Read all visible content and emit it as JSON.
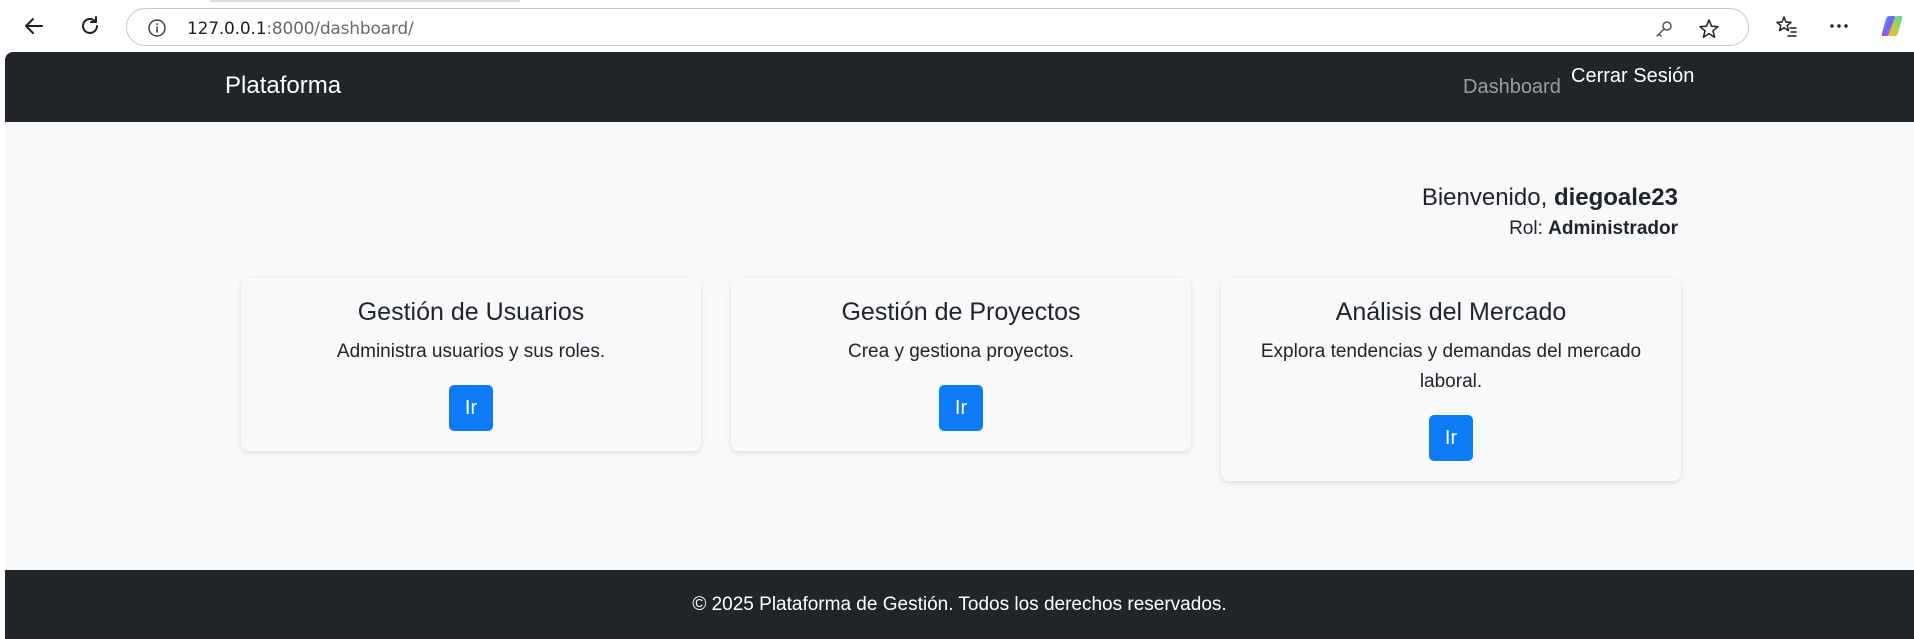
{
  "browser": {
    "url_host": "127.0.0.1",
    "url_rest": ":8000/dashboard/"
  },
  "navbar": {
    "brand": "Plataforma",
    "links": {
      "dashboard": "Dashboard",
      "logout": "Cerrar Sesión"
    }
  },
  "welcome": {
    "greeting": "Bienvenido,",
    "username": "diegoale23",
    "role_label": "Rol:",
    "role_value": "Administrador"
  },
  "cards": [
    {
      "title": "Gestión de Usuarios",
      "description": "Administra usuarios y sus roles.",
      "button": "Ir"
    },
    {
      "title": "Gestión de Proyectos",
      "description": "Crea y gestiona proyectos.",
      "button": "Ir"
    },
    {
      "title": "Análisis del Mercado",
      "description": "Explora tendencias y demandas del mercado laboral.",
      "button": "Ir"
    }
  ],
  "footer": {
    "text": "© 2025 Plataforma de Gestión. Todos los derechos reservados."
  },
  "colors": {
    "navbar_bg": "#212529",
    "page_bg": "#f8f9fa",
    "primary_button": "#0d7bf5"
  }
}
